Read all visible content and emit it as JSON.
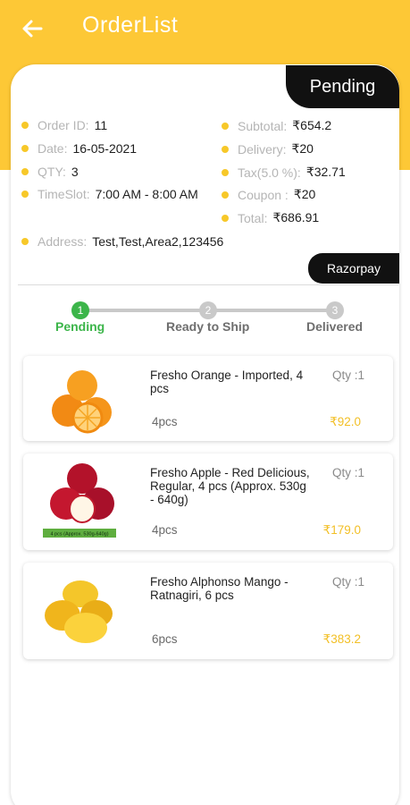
{
  "appbar": {
    "title": "OrderList",
    "back_icon": "arrow-left-icon"
  },
  "order": {
    "status": "Pending",
    "payment_method": "Razorpay",
    "left": {
      "order_id_label": "Order ID:",
      "order_id": "11",
      "date_label": "Date:",
      "date": "16-05-2021",
      "qty_label": "QTY:",
      "qty": "3",
      "timeslot_label": "TimeSlot:",
      "timeslot": "7:00 AM - 8:00 AM",
      "address_label": "Address:",
      "address": "Test,Test,Area2,123456"
    },
    "right": {
      "subtotal_label": "Subtotal:",
      "subtotal": "₹654.2",
      "delivery_label": "Delivery:",
      "delivery": "₹20",
      "tax_label": "Tax(5.0 %):",
      "tax": "₹32.71",
      "coupon_label": "Coupon :",
      "coupon": "₹20",
      "total_label": "Total:",
      "total": "₹686.91"
    }
  },
  "stepper": [
    {
      "num": "1",
      "label": "Pending",
      "active": true
    },
    {
      "num": "2",
      "label": "Ready to Ship",
      "active": false
    },
    {
      "num": "3",
      "label": "Delivered",
      "active": false
    }
  ],
  "items": [
    {
      "name": "Fresho Orange - Imported, 4 pcs",
      "qty": "Qty :1",
      "unit": "4pcs",
      "price": "₹92.0",
      "image": "orange-image"
    },
    {
      "name": "Fresho Apple - Red Delicious, Regular, 4 pcs (Approx. 530g - 640g)",
      "qty": "Qty :1",
      "unit": "4pcs",
      "price": "₹179.0",
      "image": "apple-image",
      "image_tag": "4 pcs (Approx. 530g-640g)"
    },
    {
      "name": "Fresho Alphonso Mango - Ratnagiri, 6 pcs",
      "qty": "Qty :1",
      "unit": "6pcs",
      "price": "₹383.2",
      "image": "mango-image"
    }
  ],
  "colors": {
    "brand": "#fdc836",
    "accent": "#f7c829",
    "active_step": "#3cb54a",
    "inactive_step": "#c9c9c9",
    "price": "#f2bf25"
  }
}
